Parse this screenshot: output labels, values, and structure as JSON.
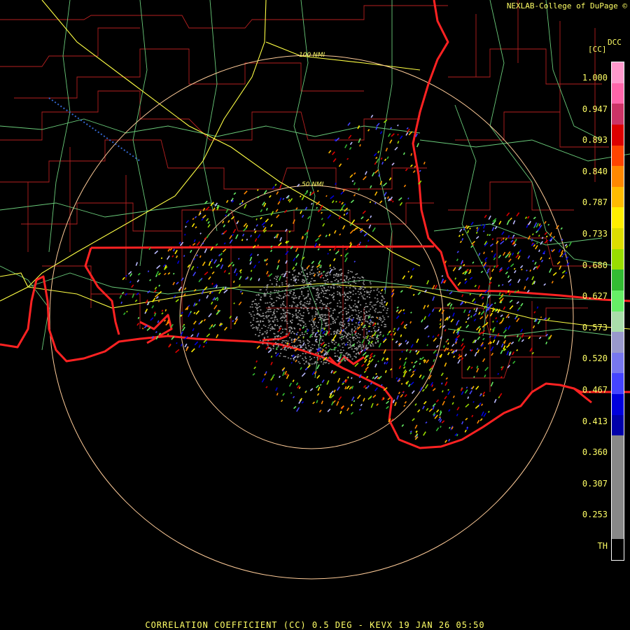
{
  "header": {
    "credit": "NEXLAB-College of DuPage ©"
  },
  "footer": {
    "caption": "CORRELATION COEFFICIENT (CC) 0.5 DEG - KEVX 19 JAN 26 05:50"
  },
  "legend": {
    "product_code": "DCC",
    "unit": "[CC]",
    "ticks": [
      "1.000",
      "0.947",
      "0.893",
      "0.840",
      "0.787",
      "0.733",
      "0.680",
      "0.627",
      "0.573",
      "0.520",
      "0.467",
      "0.413",
      "0.360",
      "0.307",
      "0.253",
      "TH"
    ],
    "colors": [
      "#ff99cc",
      "#ff66aa",
      "#cc3366",
      "#dd0000",
      "#ff4400",
      "#ff8800",
      "#ffbb00",
      "#ffee00",
      "#dddd00",
      "#99dd00",
      "#33bb33",
      "#66ee66",
      "#aaddaa",
      "#9999cc",
      "#7777ee",
      "#4444ff",
      "#0000dd",
      "#0000aa",
      "#888888",
      "#888888",
      "#888888",
      "#888888",
      "#888888",
      "#000000"
    ]
  },
  "map": {
    "range_rings": {
      "inner_label": "50 NMI",
      "outer_label": "100 NMI"
    },
    "colors": {
      "state_border": "#ff2222",
      "county": "#cc2222",
      "highway": "#ffff44",
      "road": "#66cc77",
      "ring": "#ffcc99",
      "background": "#000000"
    }
  }
}
